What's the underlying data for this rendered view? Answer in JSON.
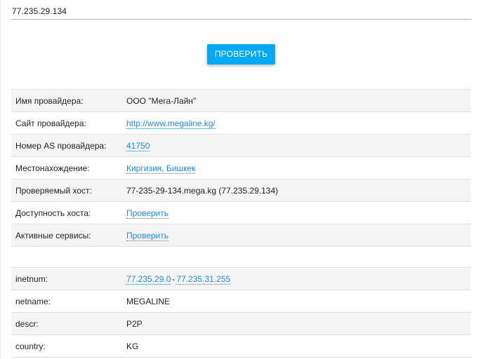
{
  "host_field": {
    "clipped_label_parts": [
      "",
      ""
    ],
    "value": "77.235.29.134"
  },
  "check_button": {
    "label": "ПРОВЕРИТЬ"
  },
  "provider": {
    "name_label": "Имя провайдера:",
    "name_value": "ООО \"Мега-Лайн\"",
    "site_label": "Сайт провайдера:",
    "site_value": "http://www.megaline.kg/",
    "as_label": "Номер AS провайдера:",
    "as_value": "41750",
    "location_label": "Местонахождение:",
    "location_value": "Киргизия, Бишкек",
    "host_label": "Проверяемый хост:",
    "host_value": "77-235-29-134.mega.kg (77.235.29.134)",
    "availability_label": "Доступность хоста:",
    "availability_link": "Проверить",
    "services_label": "Активные сервисы:",
    "services_link": "Проверить"
  },
  "whois": {
    "inetnum_label": "inetnum:",
    "inetnum_start": "77.235.29.0",
    "inetnum_sep": "-",
    "inetnum_end": "77.235.31.255",
    "netname_label": "netname:",
    "netname_value": "MEGALINE",
    "descr_label": "descr:",
    "descr_value": "P2P",
    "country_label": "country:",
    "country_value": "KG"
  },
  "colors": {
    "accent": "#03a9f4",
    "link": "#1e88e5",
    "row_alt": "#f5f5f5"
  }
}
